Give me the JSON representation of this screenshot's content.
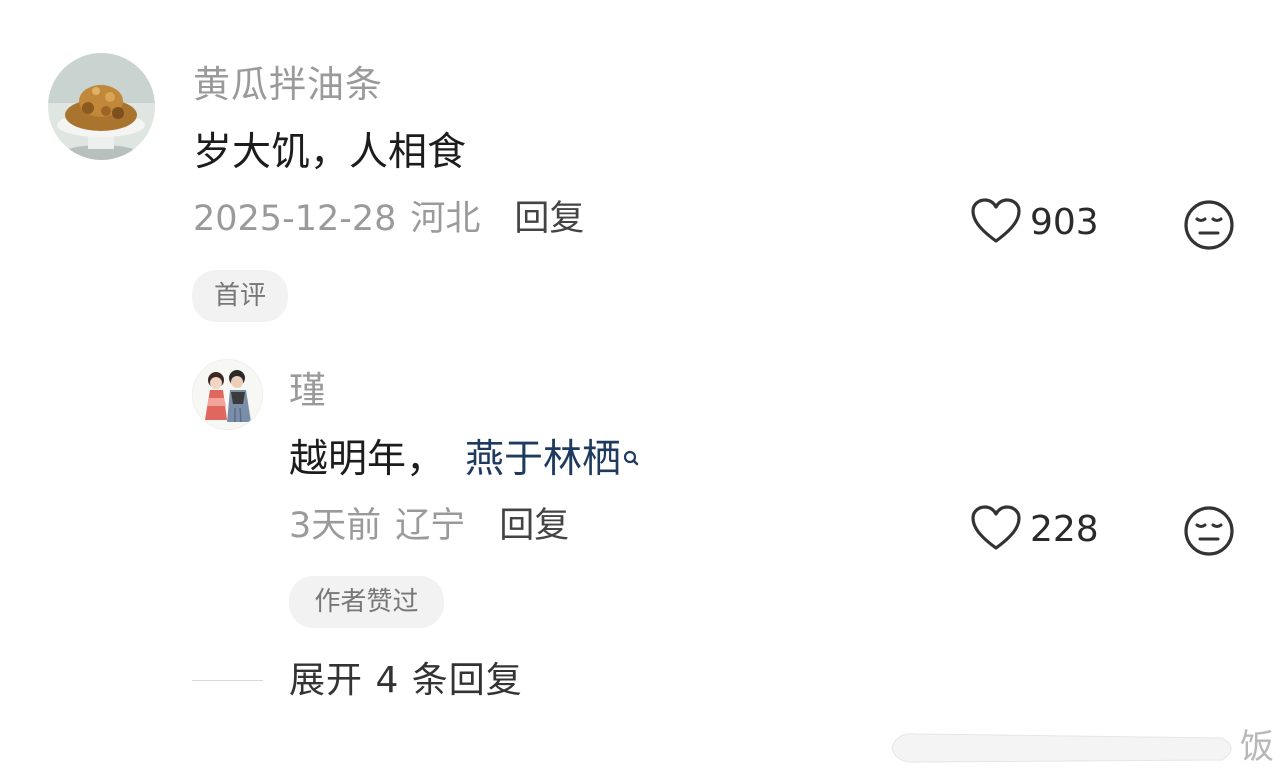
{
  "comment": {
    "username": "黄瓜拌油条",
    "text": "岁大饥，人相食",
    "date": "2025-12-28",
    "location": "河北",
    "reply_label": "回复",
    "like_count": "903",
    "badge": "首评"
  },
  "reply": {
    "username": "瑾",
    "text_prefix": "越明年，",
    "text_link": "燕于林栖",
    "date": "3天前",
    "location": "辽宁",
    "reply_label": "回复",
    "like_count": "228",
    "badge": "作者赞过"
  },
  "expand_label": "展开 4 条回复",
  "watermark_text": "饭",
  "colors": {
    "link": "#1f3a5f",
    "muted": "#9a9a9a",
    "tag_bg": "#f2f2f2"
  },
  "icons": [
    "heart-icon",
    "meh-face-icon",
    "search-icon"
  ]
}
